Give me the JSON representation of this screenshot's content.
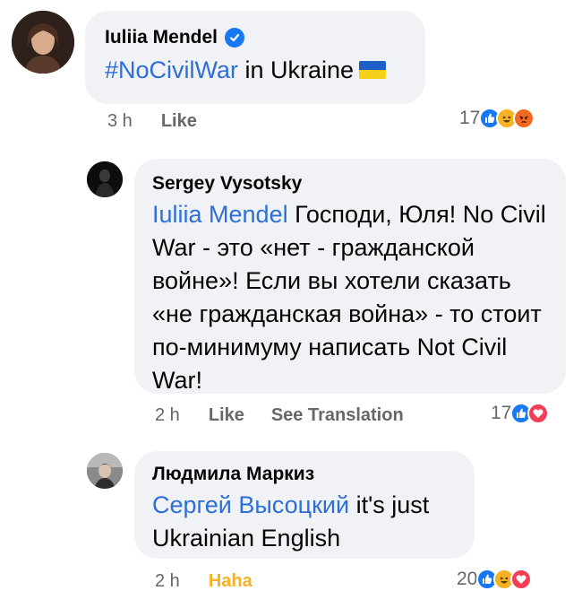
{
  "comments": [
    {
      "author": "Iuliia Mendel",
      "verified": true,
      "hashtag": "#NoCivilWar",
      "text": " in Ukraine",
      "time": "3 h",
      "actions": [
        "Like"
      ],
      "reaction_count": "17",
      "reactions": [
        "like-icon",
        "haha-icon",
        "angry-icon"
      ]
    },
    {
      "author": "Sergey  Vysotsky",
      "mention": "Iuliia Mendel",
      "text": " Господи, Юля! No Civil War - это «нет - гражданской войне»! Если вы хотели сказать «не гражданская война» - то стоит по-минимуму написать Not Civil War!",
      "time": "2 h",
      "actions": [
        "Like",
        "See Translation"
      ],
      "reaction_count": "17",
      "reactions": [
        "like-icon",
        "love-icon"
      ]
    },
    {
      "author": "Людмила Маркиз",
      "mention": "Сергей Высоцкий",
      "text": " it's just Ukrainian English",
      "time": "2 h",
      "actions": [
        "Haha"
      ],
      "reaction_count": "20",
      "reactions": [
        "like-icon",
        "haha-icon",
        "love-icon"
      ]
    }
  ],
  "colors": {
    "bubble": "#f0f2f5",
    "mention": "#2d6fd6",
    "haha_active": "#f7b125",
    "like": "#1877f2",
    "love": "#f33e58"
  }
}
